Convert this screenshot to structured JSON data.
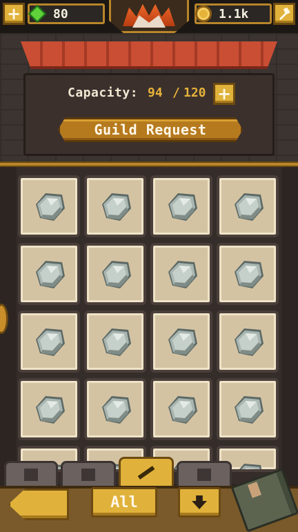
{
  "topbar": {
    "add_label": "+",
    "gems": "80",
    "coins": "1.1k",
    "icons": {
      "gem": "green-gem-icon",
      "coin": "gold-coin-icon",
      "settings": "wrench-icon",
      "crest": "flame-crest-icon"
    }
  },
  "header": {
    "capacity_label": "Capacity:",
    "capacity_current": "94",
    "capacity_separator": "/",
    "capacity_max": "120",
    "capacity_add_label": "+",
    "guild_button_label": "Guild Request"
  },
  "inventory": {
    "item_type": "iron-ore-icon",
    "full_rows": 4,
    "columns": 4,
    "partial_row_slots": 4
  },
  "tabs": [
    {
      "icon": "potion-icon",
      "active": false
    },
    {
      "icon": "boot-icon",
      "active": false
    },
    {
      "icon": "sword-icon",
      "active": true
    },
    {
      "icon": "gem-outline-icon",
      "active": false
    }
  ],
  "bottom": {
    "back_icon": "left-arrow-icon",
    "filter_label": "All",
    "sort_icon": "sort-down-icon",
    "book_icon": "recipe-book-icon"
  },
  "colors": {
    "gold": "#e0b23b",
    "accent_text": "#e6b23a",
    "slot_bg": "#d4c3a3",
    "awning": "#b8432d"
  }
}
